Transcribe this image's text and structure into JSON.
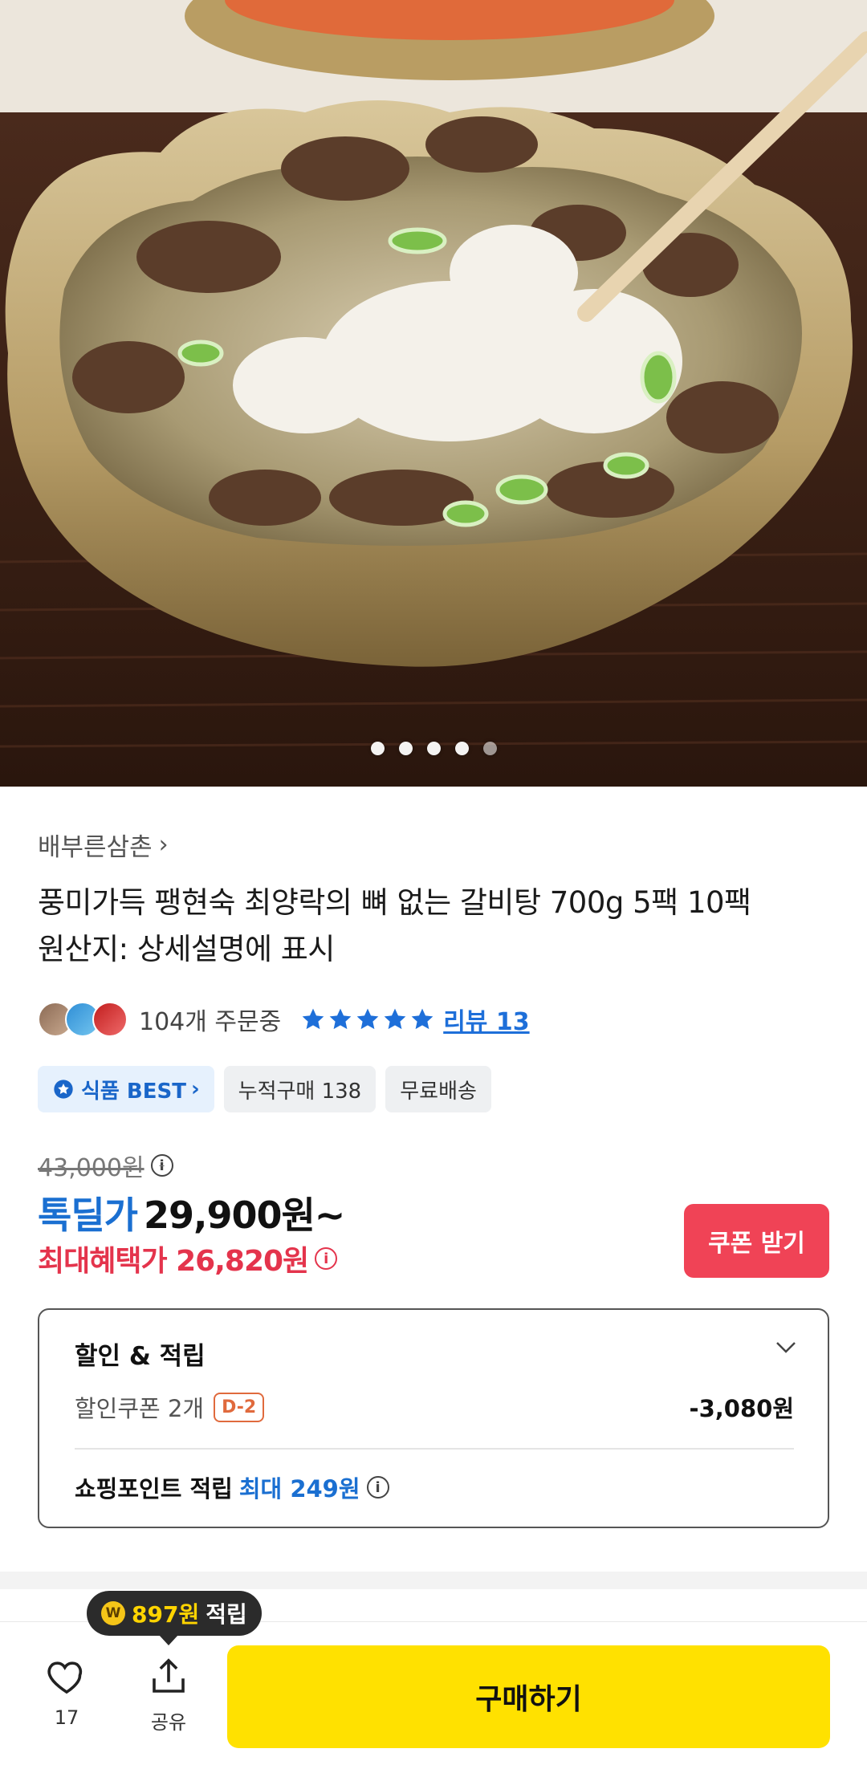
{
  "hero": {
    "slides": 5,
    "active_slide": 5
  },
  "product": {
    "seller": "배부른삼촌",
    "title_line1": "풍미가득 팽현숙 최양락의 뼈 없는 갈비탕 700g 5팩 10팩",
    "title_line2": "원산지: 상세설명에 표시",
    "orders": "104개 주문중",
    "rating_stars": 5,
    "review_link": "리뷰 13",
    "tags": {
      "best": "식품 BEST",
      "cumulative": "누적구매 138",
      "shipping": "무료배송"
    }
  },
  "price": {
    "original": "43,000원",
    "deal_label": "톡딜가",
    "deal_price": "29,900원~",
    "max_benefit": "최대혜택가 26,820원",
    "coupon_button": "쿠폰 받기"
  },
  "discount": {
    "title": "할인 & 적립",
    "coupon_label": "할인쿠폰 2개",
    "dday": "D-2",
    "coupon_amount": "-3,080원",
    "point_label": "쇼핑포인트 적립",
    "point_value": "최대 249원"
  },
  "bottom_bar": {
    "tooltip_amount": "897원",
    "tooltip_suffix": "적립",
    "like_count": "17",
    "share_label": "공유",
    "buy_label": "구매하기"
  },
  "colors": {
    "accent_blue": "#1a6fd1",
    "accent_red": "#e4344c",
    "buy_yellow": "#ffe100",
    "coupon_red": "#f04356"
  }
}
